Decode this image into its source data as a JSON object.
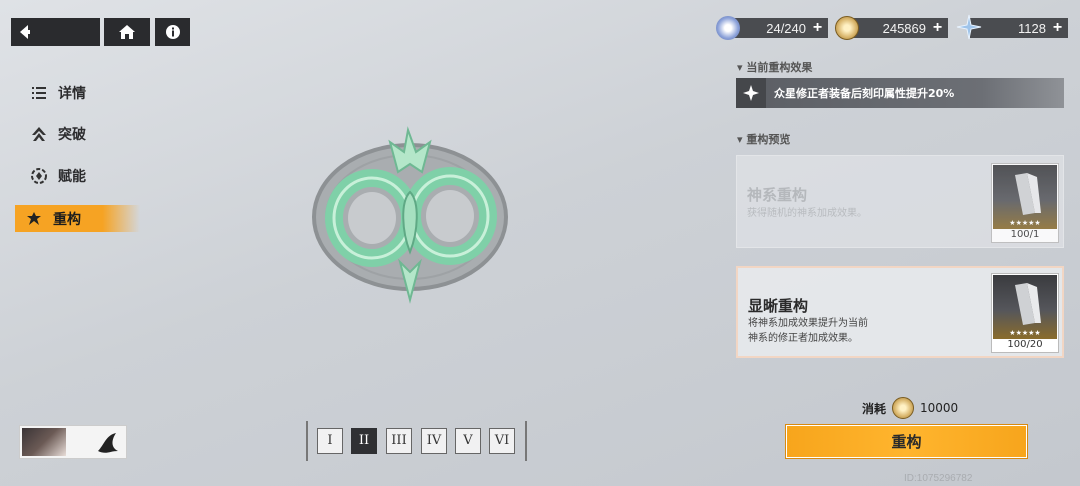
{
  "resources": [
    {
      "name": "stamina",
      "value": "24/240",
      "icon": "stamina-crystal-icon"
    },
    {
      "name": "coins",
      "value": "245869",
      "icon": "coin-icon"
    },
    {
      "name": "stars",
      "value": "1128",
      "icon": "star-shard-icon"
    }
  ],
  "nav": {
    "items": [
      {
        "label": "详情",
        "icon": "details-icon"
      },
      {
        "label": "突破",
        "icon": "breakthrough-icon"
      },
      {
        "label": "赋能",
        "icon": "empower-icon"
      },
      {
        "label": "重构",
        "icon": "rebuild-icon",
        "active": true
      }
    ]
  },
  "current_effect": {
    "title": "▾ 当前重构效果",
    "text": "众星修正者装备后刻印属性提升20%"
  },
  "preview": {
    "title": "▾ 重构预览",
    "cards": [
      {
        "title": "神系重构",
        "desc": "获得随机的神系加成效果。",
        "count": "100/1",
        "disabled": true
      },
      {
        "title": "显晰重构",
        "desc_line1": "将神系加成效果提升为当前",
        "desc_line2": "神系的修正者加成效果。",
        "count": "100/20",
        "disabled": false
      }
    ]
  },
  "cost": {
    "label": "消耗",
    "value": "10000"
  },
  "confirm_label": "重构",
  "user_id": "ID:1075296782",
  "tiers": [
    "I",
    "II",
    "III",
    "IV",
    "V",
    "VI"
  ],
  "active_tier": "II",
  "colors": {
    "accent": "#f6a323",
    "emblem": "#8fd9b3"
  }
}
